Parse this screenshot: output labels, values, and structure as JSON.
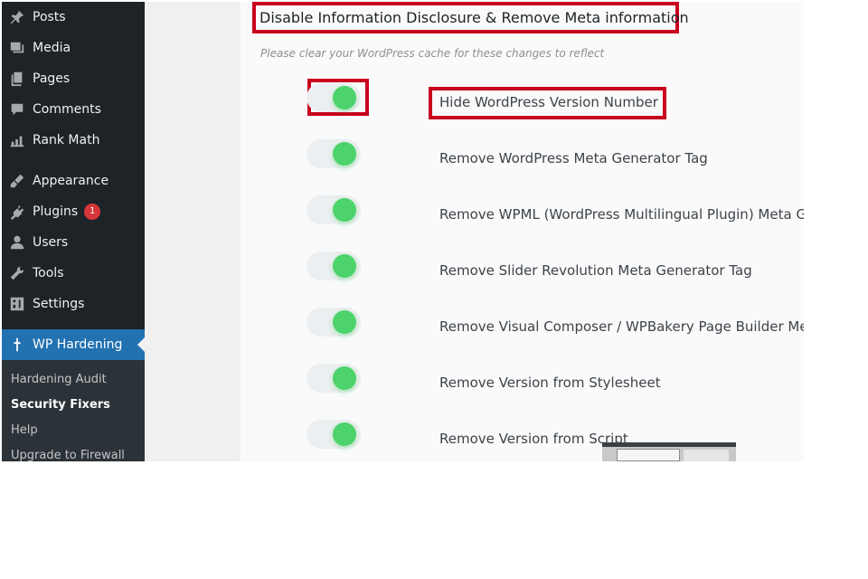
{
  "sidebar": {
    "items": [
      {
        "label": "Posts",
        "icon": "pin-icon"
      },
      {
        "label": "Media",
        "icon": "media-icon"
      },
      {
        "label": "Pages",
        "icon": "pages-icon"
      },
      {
        "label": "Comments",
        "icon": "comment-icon"
      },
      {
        "label": "Rank Math",
        "icon": "chart-icon"
      },
      {
        "label": "Appearance",
        "icon": "brush-icon"
      },
      {
        "label": "Plugins",
        "icon": "plugin-icon",
        "badge": "1"
      },
      {
        "label": "Users",
        "icon": "user-icon"
      },
      {
        "label": "Tools",
        "icon": "wrench-icon"
      },
      {
        "label": "Settings",
        "icon": "settings-icon"
      },
      {
        "label": "WP Hardening",
        "icon": "shield-icon",
        "active": true
      }
    ],
    "submenu": [
      {
        "label": "Hardening Audit"
      },
      {
        "label": "Security Fixers",
        "current": true
      },
      {
        "label": "Help"
      },
      {
        "label": "Upgrade to Firewall"
      }
    ]
  },
  "main": {
    "section_title": "Disable Information Disclosure & Remove Meta information",
    "notice": "Please clear your WordPress cache for these changes to reflect",
    "options": [
      {
        "label": "Hide WordPress Version Number",
        "enabled": true
      },
      {
        "label": "Remove WordPress Meta Generator Tag",
        "enabled": true
      },
      {
        "label": "Remove WPML (WordPress Multilingual Plugin) Meta G",
        "enabled": true
      },
      {
        "label": "Remove Slider Revolution Meta Generator Tag",
        "enabled": true
      },
      {
        "label": "Remove Visual Composer / WPBakery Page Builder Me",
        "enabled": true
      },
      {
        "label": "Remove Version from Stylesheet",
        "enabled": true
      },
      {
        "label": "Remove Version from Script",
        "enabled": true
      }
    ]
  },
  "colors": {
    "sidebar_bg": "#1d2327",
    "active_bg": "#2271b1",
    "toggle_on": "#4cd36b",
    "highlight_box": "#c8001e",
    "badge": "#d63638"
  }
}
